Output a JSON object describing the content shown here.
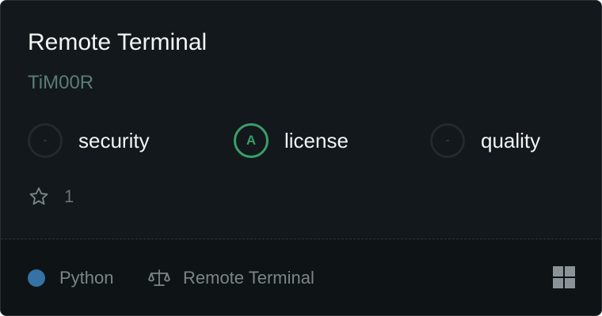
{
  "card": {
    "title": "Remote Terminal",
    "owner": "TiM00R"
  },
  "scores": [
    {
      "grade": "-",
      "label": "security"
    },
    {
      "grade": "A",
      "label": "license"
    },
    {
      "grade": "-",
      "label": "quality"
    }
  ],
  "stars": {
    "icon": "star-icon",
    "count": "1"
  },
  "footer": {
    "language": "Python",
    "language_color": "#3572A5",
    "license_icon": "scale-icon",
    "license": "Remote Terminal",
    "grid_icon": "grid-icon"
  },
  "colors": {
    "card_background": "#12181b",
    "grade_a": "#3a9e6a",
    "owner_text": "#5b7d77"
  }
}
